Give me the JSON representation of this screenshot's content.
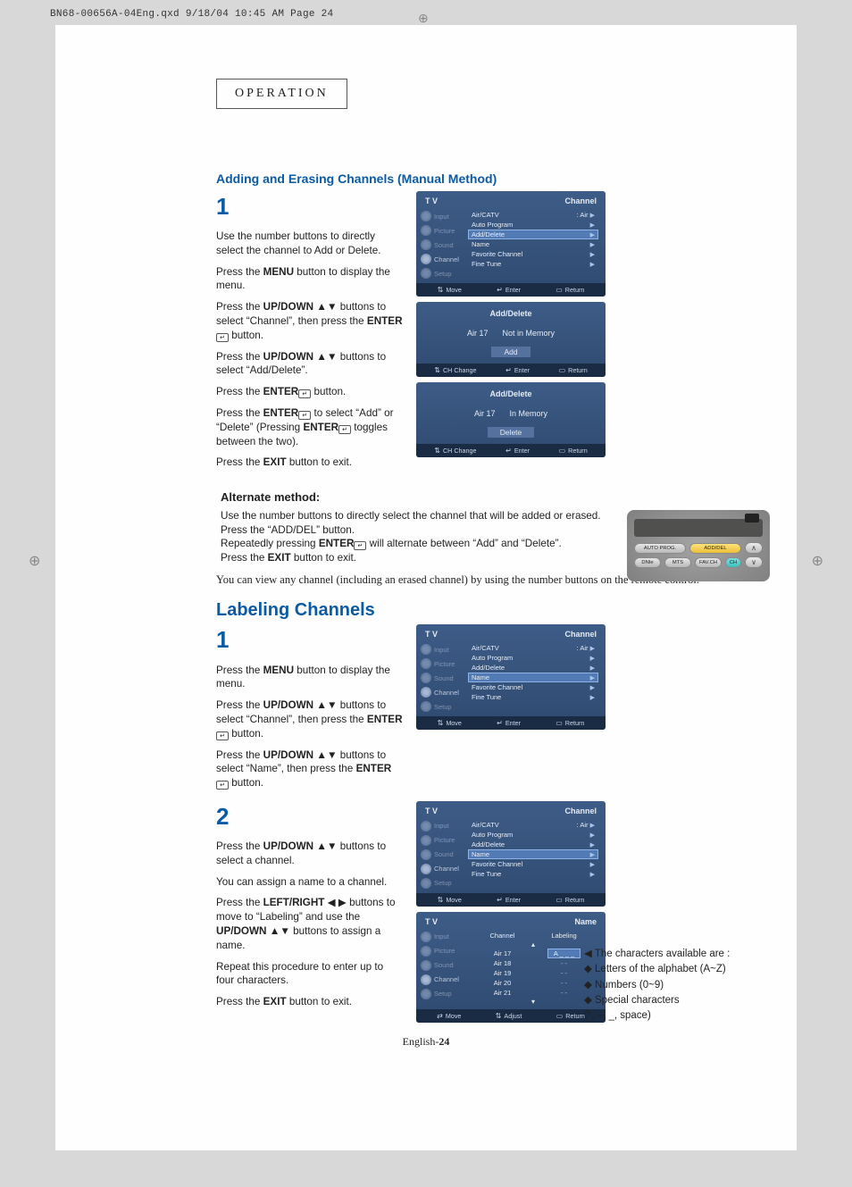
{
  "print_header": "BN68-00656A-04Eng.qxd  9/18/04 10:45 AM  Page 24",
  "operation_label": "OPERATION",
  "section_a_title": "Adding and Erasing Channels (Manual Method)",
  "step1_a": {
    "num": "1",
    "p1": "Use the number buttons to directly select the channel to Add or Delete.",
    "p2a": "Press the ",
    "p2b": "MENU",
    "p2c": " button to display the menu.",
    "p3a": "Press the ",
    "p3b": "UP/DOWN",
    "p3ic": " ▲▼",
    "p3c": " buttons to select “Channel”, then press the ",
    "p3d": "ENTER",
    "p3e": " button.",
    "p4a": "Press the ",
    "p4b": "UP/DOWN",
    "p4ic": " ▲▼",
    "p4c": " buttons to select “Add/Delete”.",
    "p5a": "Press the ",
    "p5b": "ENTER",
    "p5c": " button.",
    "p6a": "Press the ",
    "p6b": "ENTER",
    "p6c": " to select “Add” or “Delete” (Pressing ",
    "p6d": "ENTER",
    "p6e": "  toggles between the two).",
    "p7a": "Press the ",
    "p7b": "EXIT",
    "p7c": " button to exit."
  },
  "alt": {
    "title": "Alternate method:",
    "p1": "Use the number buttons to directly select the channel that will be added or erased. Press the “ADD/DEL” button.",
    "p2a": "Repeatedly pressing ",
    "p2b": "ENTER",
    "p2c": "  will alternate between “Add” and “Delete”.",
    "p3a": "Press the ",
    "p3b": "EXIT",
    "p3c": " button to exit."
  },
  "serif_note": "You can view any channel (including an erased channel) by using the number buttons on the remote control.",
  "section_b_title": "Labeling Channels",
  "step1_b": {
    "num": "1",
    "p1a": "Press the ",
    "p1b": "MENU",
    "p1c": " button to display the menu.",
    "p2a": "Press the ",
    "p2b": "UP/DOWN",
    "p2ic": " ▲▼",
    "p2c": " buttons to select “Channel”, then press the ",
    "p2d": "ENTER",
    "p2e": "  button.",
    "p3a": "Press the ",
    "p3b": "UP/DOWN",
    "p3ic": " ▲▼ ",
    "p3c": " buttons to select “Name”, then press the ",
    "p3d": "ENTER",
    "p3e": "  button."
  },
  "step2_b": {
    "num": "2",
    "p1a": "Press the ",
    "p1b": "UP/DOWN",
    "p1ic": " ▲▼ ",
    "p1c": " buttons to select a channel.",
    "p2": "You can assign a name to a channel.",
    "p3a": "Press the ",
    "p3b": "LEFT/RIGHT",
    "p3ic": " ◀ ▶ ",
    "p3c": " buttons to move to “Labeling” and use the ",
    "p3d": "UP/DOWN",
    "p3ic2": " ▲▼",
    "p3e": " buttons to assign a name.",
    "p4": "Repeat this procedure to enter up to four characters.",
    "p5a": "Press the ",
    "p5b": "EXIT",
    "p5c": " button to exit."
  },
  "osd": {
    "tv": "T V",
    "channel": "Channel",
    "name_title": "Name",
    "sidebar": [
      "Input",
      "Picture",
      "Sound",
      "Channel",
      "Setup"
    ],
    "menu_add": [
      "Air/CATV",
      "Auto Program",
      "Add/Delete",
      "Name",
      "Favorite Channel",
      "Fine Tune"
    ],
    "sel_add": 2,
    "val_air": ":   Air",
    "addDeleteTitle": "Add/Delete",
    "air17": "Air  17",
    "notmem": "Not in Memory",
    "inmem": "In Memory",
    "btn_add": "Add",
    "btn_del": "Delete",
    "foot_move": "Move",
    "foot_enter": "Enter",
    "foot_return": "Return",
    "foot_ch": "CH Change",
    "foot_adjust": "Adjust",
    "name_cols": [
      "Channel",
      "Labeling"
    ],
    "name_rows": [
      {
        "ch": "Air  17",
        "lab": "A _ _ _"
      },
      {
        "ch": "Air  18",
        "lab": "- -"
      },
      {
        "ch": "Air  19",
        "lab": "- -"
      },
      {
        "ch": "Air  20",
        "lab": "- -"
      },
      {
        "ch": "Air  21",
        "lab": "- -"
      }
    ],
    "sel_name": 3
  },
  "remote": {
    "row1": [
      "AUTO PROG.",
      "ADD/DEL"
    ],
    "row2": [
      "DNIe",
      "MTS",
      "FAV.CH",
      "CH"
    ]
  },
  "charnote": {
    "head": "◀ The characters available are :",
    "a": "◆ Letters of the alphabet (A~Z)",
    "b": "◆ Numbers (0~9)",
    "c": "◆ Special characters",
    "d": "      (*, –, _, space)"
  },
  "footer": {
    "label": "English-",
    "page": "24"
  }
}
